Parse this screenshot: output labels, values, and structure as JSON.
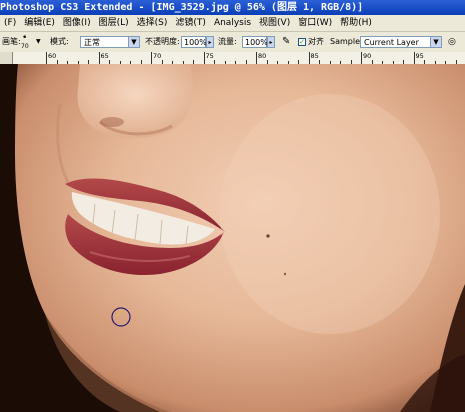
{
  "window": {
    "title": "Photoshop CS3 Extended - [IMG_3529.jpg @ 56% (图层 1, RGB/8)]"
  },
  "menu": {
    "items": [
      "(F)",
      "编辑(E)",
      "图像(I)",
      "图层(L)",
      "选择(S)",
      "滤镜(T)",
      "Analysis",
      "视图(V)",
      "窗口(W)",
      "帮助(H)"
    ]
  },
  "options": {
    "brush_label": "画笔:",
    "brush_size": "70",
    "mode_label": "模式:",
    "mode_value": "正常",
    "opacity_label": "不透明度:",
    "opacity_value": "100%",
    "flow_label": "流量:",
    "flow_value": "100%",
    "aligned_label": "对齐",
    "sample_label": "Sample:",
    "sample_value": "Current Layer"
  },
  "ruler": {
    "labels": [
      "60",
      "65",
      "70",
      "75",
      "80",
      "85",
      "90",
      "95"
    ]
  }
}
